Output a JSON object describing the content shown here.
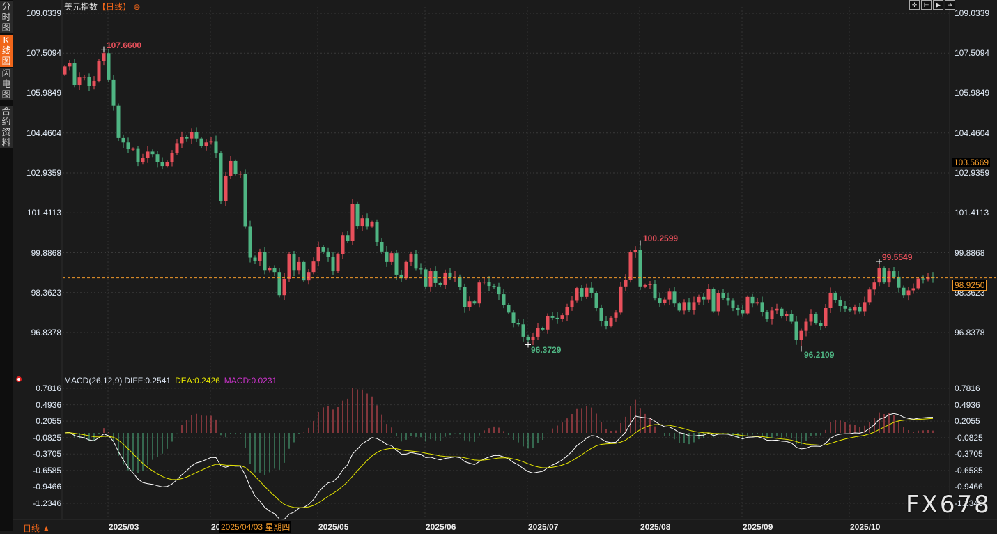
{
  "sidebar": {
    "tabs": [
      {
        "label": "分时图",
        "active": false
      },
      {
        "label": "K线图",
        "active": true
      },
      {
        "label": "闪电图",
        "active": false
      },
      {
        "label": "合约资料",
        "active": false
      }
    ]
  },
  "header": {
    "title": "美元指数",
    "period": "【日线】",
    "add_icon": "circle-plus-icon"
  },
  "toolbar_icons": [
    "crosshair-icon",
    "fit-left-icon",
    "play-right-icon",
    "to-end-icon"
  ],
  "colors": {
    "up": "#e8505b",
    "down": "#4fb583",
    "accent": "#f0661a",
    "last_price": "#f0992a",
    "diff": "#ffffff",
    "dea": "#e6e600",
    "macd": "#cc33cc"
  },
  "chart_data": [
    {
      "type": "candlestick",
      "title": "美元指数",
      "y_ticks": [
        "109.0339",
        "107.5094",
        "105.9849",
        "104.4604",
        "102.9359",
        "101.4113",
        "99.8868",
        "98.3623",
        "96.8378"
      ],
      "ylim": [
        96.8378,
        109.0339
      ],
      "x_ticks": [
        "2025/03",
        "2025/04",
        "2025/05",
        "2025/06",
        "2025/07",
        "2025/08",
        "2025/09",
        "2025/10"
      ],
      "x_tick_bar_index": [
        9,
        30,
        52,
        74,
        95,
        118,
        139,
        161
      ],
      "first_open": 106.7,
      "close": [
        107.0,
        107.14,
        106.29,
        106.58,
        106.6,
        106.26,
        106.45,
        107.22,
        107.51,
        106.48,
        105.5,
        104.27,
        104.1,
        103.84,
        103.85,
        103.36,
        103.5,
        103.75,
        103.65,
        103.35,
        103.2,
        103.35,
        103.7,
        104.07,
        104.3,
        104.25,
        104.5,
        104.25,
        103.95,
        104.1,
        104.15,
        103.68,
        101.87,
        102.83,
        103.39,
        102.9,
        102.9,
        100.9,
        99.7,
        99.58,
        99.9,
        99.2,
        99.3,
        99.15,
        98.27,
        98.89,
        99.82,
        99.2,
        99.53,
        98.83,
        99.15,
        99.55,
        100.1,
        99.93,
        99.74,
        99.18,
        99.82,
        100.56,
        100.35,
        101.74,
        100.91,
        101.2,
        100.9,
        101.05,
        100.3,
        99.93,
        99.53,
        99.87,
        99.05,
        98.91,
        99.53,
        99.82,
        99.28,
        99.25,
        98.6,
        99.18,
        98.73,
        98.65,
        99.13,
        98.94,
        98.97,
        98.57,
        97.8,
        98.03,
        97.95,
        98.75,
        98.78,
        98.62,
        98.6,
        98.3,
        97.9,
        97.6,
        97.2,
        97.15,
        96.68,
        96.57,
        96.68,
        97.0,
        96.95,
        97.46,
        97.4,
        97.35,
        97.5,
        97.8,
        98.05,
        98.54,
        98.2,
        98.55,
        98.35,
        97.77,
        97.28,
        97.1,
        97.4,
        97.6,
        98.6,
        98.86,
        99.9,
        100.0,
        98.6,
        98.65,
        98.7,
        98.14,
        97.98,
        98.1,
        98.4,
        97.95,
        97.68,
        98.0,
        97.7,
        98.0,
        98.2,
        98.1,
        98.5,
        97.65,
        98.35,
        98.15,
        98.05,
        97.77,
        97.7,
        97.57,
        98.2,
        97.95,
        98.0,
        97.63,
        97.35,
        97.68,
        97.75,
        97.45,
        97.55,
        97.25,
        96.55,
        96.9,
        97.25,
        97.55,
        97.2,
        97.1,
        97.77,
        98.35,
        98.08,
        97.85,
        97.75,
        97.68,
        97.8,
        97.65,
        98.0,
        98.48,
        98.75,
        99.3,
        98.75,
        99.18,
        98.97,
        98.55,
        98.27,
        98.45,
        98.53,
        98.9,
        98.88,
        98.94,
        98.925
      ],
      "annotations": [
        {
          "label": "107.6600",
          "bar_index": 8,
          "value": 107.66,
          "kind": "high"
        },
        {
          "label": "96.3729",
          "bar_index": 95,
          "value": 96.3729,
          "kind": "low"
        },
        {
          "label": "100.2599",
          "bar_index": 118,
          "value": 100.2599,
          "kind": "high"
        },
        {
          "label": "96.2109",
          "bar_index": 151,
          "value": 96.2109,
          "kind": "low"
        },
        {
          "label": "99.5549",
          "bar_index": 167,
          "value": 99.5549,
          "kind": "high"
        }
      ],
      "last_price": "98.9250",
      "crosshair_price": "103.5669",
      "crosshair_date": "2025/04/03 星期四"
    },
    {
      "type": "macd",
      "legend": {
        "name": "MACD(26,12,9)",
        "diff": "DIFF:0.2541",
        "dea": "DEA:0.2426",
        "macd": "MACD:0.0231"
      },
      "y_ticks": [
        "0.7816",
        "0.4936",
        "0.2055",
        "-0.0825",
        "-0.3705",
        "-0.6585",
        "-0.9466",
        "-1.2346"
      ],
      "ylim": [
        -1.2346,
        0.7816
      ]
    }
  ],
  "footer": {
    "period_label": "日线 ▲"
  },
  "watermark": "FX678"
}
